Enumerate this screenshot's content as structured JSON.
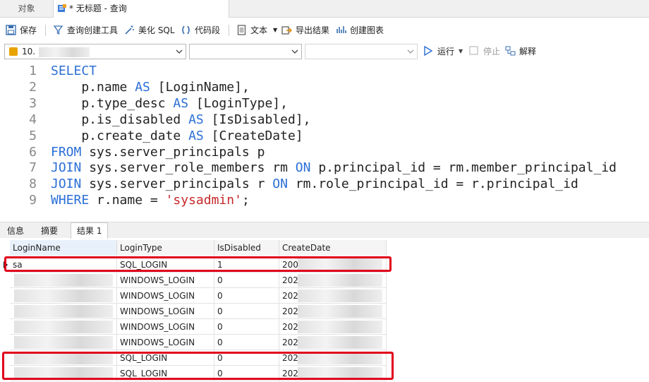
{
  "tabs": {
    "objects": "对象",
    "query": "* 无标题 - 查询"
  },
  "toolbar": {
    "save": "保存",
    "query_builder": "查询创建工具",
    "beautify": "美化 SQL",
    "snippet": "代码段",
    "text": "文本",
    "export": "导出结果",
    "chart": "创建图表"
  },
  "connection": {
    "server": "10.",
    "run": "运行",
    "stop": "停止",
    "explain": "解释"
  },
  "editor": {
    "lines": [
      {
        "n": "1",
        "parts": [
          {
            "t": "SELECT",
            "c": "kw"
          }
        ]
      },
      {
        "n": "2",
        "parts": [
          {
            "t": "    p.name ",
            "c": "id"
          },
          {
            "t": "AS",
            "c": "kw"
          },
          {
            "t": " [LoginName],",
            "c": "id"
          }
        ]
      },
      {
        "n": "3",
        "parts": [
          {
            "t": "    p.type_desc ",
            "c": "id"
          },
          {
            "t": "AS",
            "c": "kw"
          },
          {
            "t": " [LoginType],",
            "c": "id"
          }
        ]
      },
      {
        "n": "4",
        "parts": [
          {
            "t": "    p.is_disabled ",
            "c": "id"
          },
          {
            "t": "AS",
            "c": "kw"
          },
          {
            "t": " [IsDisabled],",
            "c": "id"
          }
        ]
      },
      {
        "n": "5",
        "parts": [
          {
            "t": "    p.create_date ",
            "c": "id"
          },
          {
            "t": "AS",
            "c": "kw"
          },
          {
            "t": " [CreateDate]",
            "c": "id"
          }
        ]
      },
      {
        "n": "6",
        "parts": [
          {
            "t": "FROM",
            "c": "kw"
          },
          {
            "t": " sys.server_principals p",
            "c": "id"
          }
        ]
      },
      {
        "n": "7",
        "parts": [
          {
            "t": "JOIN",
            "c": "kw"
          },
          {
            "t": " sys.server_role_members rm ",
            "c": "id"
          },
          {
            "t": "ON",
            "c": "kw"
          },
          {
            "t": " p.principal_id = rm.member_principal_id",
            "c": "id"
          }
        ]
      },
      {
        "n": "8",
        "parts": [
          {
            "t": "JOIN",
            "c": "kw"
          },
          {
            "t": " sys.server_principals r ",
            "c": "id"
          },
          {
            "t": "ON",
            "c": "kw"
          },
          {
            "t": " rm.role_principal_id = r.principal_id",
            "c": "id"
          }
        ]
      },
      {
        "n": "9",
        "parts": [
          {
            "t": "WHERE",
            "c": "kw"
          },
          {
            "t": " r.name = ",
            "c": "id"
          },
          {
            "t": "'sysadmin'",
            "c": "str"
          },
          {
            "t": ";",
            "c": "id"
          }
        ]
      }
    ]
  },
  "result_tabs": {
    "info": "信息",
    "summary": "摘要",
    "result": "结果 1"
  },
  "grid": {
    "columns": [
      "LoginName",
      "LoginType",
      "IsDisabled",
      "CreateDate"
    ],
    "rows": [
      [
        "sa",
        "SQL_LOGIN",
        "1",
        "200"
      ],
      [
        "",
        "WINDOWS_LOGIN",
        "0",
        "202"
      ],
      [
        "",
        "WINDOWS_LOGIN",
        "0",
        "202"
      ],
      [
        "",
        "WINDOWS_LOGIN",
        "0",
        "202"
      ],
      [
        "",
        "WINDOWS_LOGIN",
        "0",
        "202"
      ],
      [
        "",
        "WINDOWS_LOGIN",
        "0",
        "202"
      ],
      [
        "",
        "SQL_LOGIN",
        "0",
        "202"
      ],
      [
        "",
        "SQL_LOGIN",
        "0",
        "202"
      ]
    ]
  },
  "colors": {
    "keyword": "#2b6fd6",
    "string": "#c62828",
    "highlight": "#e0001b"
  }
}
